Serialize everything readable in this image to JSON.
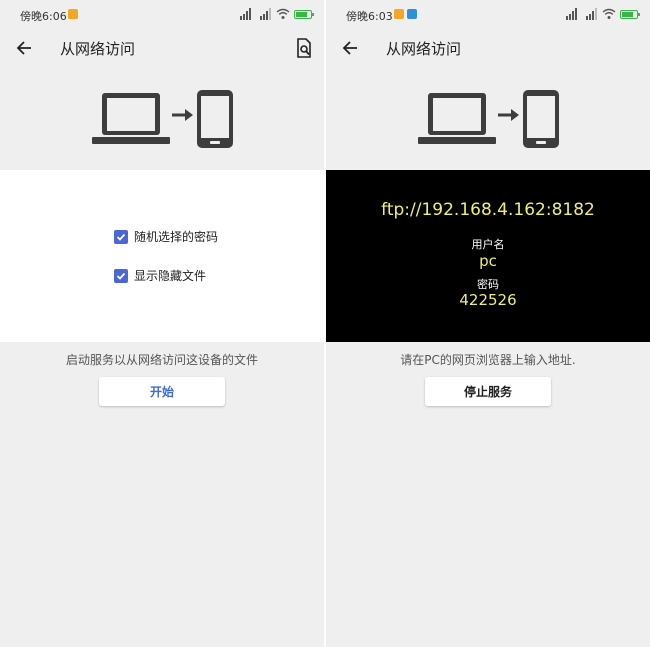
{
  "left": {
    "status": {
      "time": "傍晚6:06"
    },
    "toolbar": {
      "title": "从网络访问"
    },
    "options": [
      {
        "label": "随机选择的密码",
        "checked": true
      },
      {
        "label": "显示隐藏文件",
        "checked": true
      }
    ],
    "hint": "启动服务以从网络访问这设备的文件",
    "button_label": "开始"
  },
  "right": {
    "status": {
      "time": "傍晚6:03"
    },
    "toolbar": {
      "title": "从网络访问"
    },
    "server": {
      "url": "ftp://192.168.4.162:8182",
      "username_label": "用户名",
      "username": "pc",
      "password_label": "密码",
      "password": "422526"
    },
    "hint": "请在PC的网页浏览器上输入地址.",
    "button_label": "停止服务"
  },
  "colors": {
    "accent": "#4a67d6",
    "ftp_text": "#f2ef6a",
    "battery": "#3bb54a",
    "background": "#efeff0"
  },
  "icons": [
    "back-arrow-icon",
    "search-file-icon",
    "laptop-icon",
    "arrow-right-icon",
    "phone-icon",
    "checkbox-checked-icon",
    "signal-icon",
    "wifi-icon",
    "battery-icon"
  ]
}
